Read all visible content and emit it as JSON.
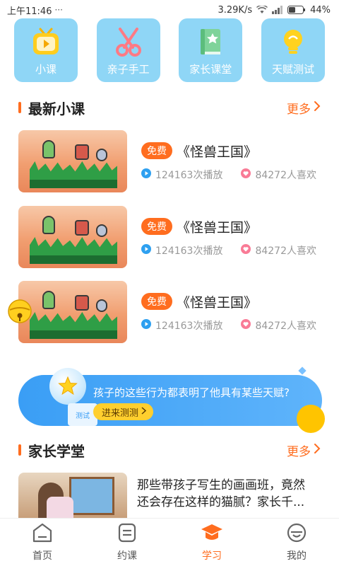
{
  "status_bar": {
    "time": "上午11:46",
    "speed": "3.29K/s",
    "battery": "44%"
  },
  "categories": [
    {
      "label": "小课",
      "icon": "tv-play-icon"
    },
    {
      "label": "亲子手工",
      "icon": "scissors-icon"
    },
    {
      "label": "家长课堂",
      "icon": "book-star-icon"
    },
    {
      "label": "天赋测试",
      "icon": "lightbulb-icon"
    }
  ],
  "latest": {
    "title": "最新小课",
    "more": "更多",
    "courses": [
      {
        "badge": "免费",
        "title": "《怪兽王国》",
        "plays": "124163次播放",
        "likes": "84272人喜欢"
      },
      {
        "badge": "免费",
        "title": "《怪兽王国》",
        "plays": "124163次播放",
        "likes": "84272人喜欢"
      },
      {
        "badge": "免费",
        "title": "《怪兽王国》",
        "plays": "124163次播放",
        "likes": "84272人喜欢"
      }
    ]
  },
  "banner": {
    "text": "孩子的这些行为都表明了他具有某些天赋?",
    "button": "进来测测",
    "box_label": "测试"
  },
  "parents": {
    "title": "家长学堂",
    "more": "更多",
    "article_line1": "那些带孩子写生的画画班，竟然",
    "article_line2": "还会存在这样的猫腻？家长千..."
  },
  "nav": [
    {
      "label": "首页",
      "icon": "home-icon"
    },
    {
      "label": "约课",
      "icon": "booking-icon"
    },
    {
      "label": "学习",
      "icon": "graduation-cap-icon"
    },
    {
      "label": "我的",
      "icon": "profile-icon"
    }
  ],
  "colors": {
    "accent": "#ff6d1f",
    "tile": "#8fd6f6",
    "banner": "#3a9ef5"
  }
}
